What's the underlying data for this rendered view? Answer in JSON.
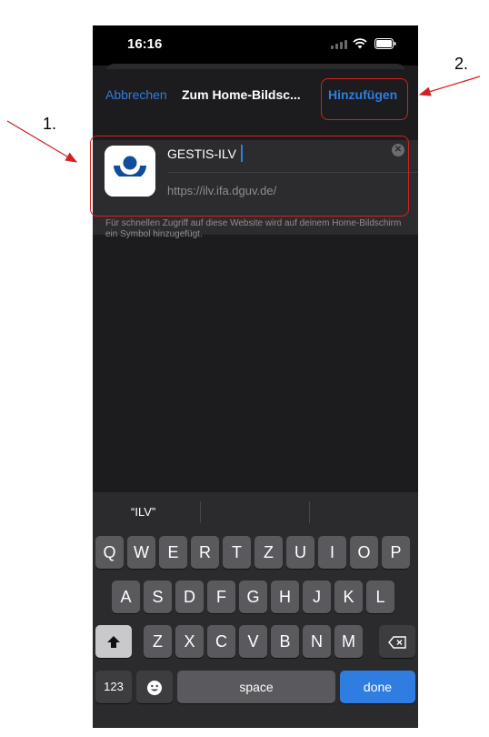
{
  "status_bar": {
    "time": "16:16"
  },
  "navbar": {
    "cancel_label": "Abbrechen",
    "title": "Zum Home-Bildsc...",
    "add_label": "Hinzufügen"
  },
  "shortcut": {
    "name": "GESTIS-ILV",
    "url": "https://ilv.ifa.dguv.de/",
    "hint": "Für schnellen Zugriff auf diese Website wird auf deinem Home-Bildschirm ein Symbol hinzugefügt."
  },
  "keyboard": {
    "suggestion": "“ILV”",
    "row1": [
      "Q",
      "W",
      "E",
      "R",
      "T",
      "Z",
      "U",
      "I",
      "O",
      "P"
    ],
    "row2": [
      "A",
      "S",
      "D",
      "F",
      "G",
      "H",
      "J",
      "K",
      "L"
    ],
    "row3": [
      "Z",
      "X",
      "C",
      "V",
      "B",
      "N",
      "M"
    ],
    "numbers_label": "123",
    "space_label": "space",
    "done_label": "done"
  },
  "annotations": {
    "label_1": "1.",
    "label_2": "2."
  },
  "colors": {
    "accent": "#2f7de1",
    "annotation": "#d42020",
    "icon_blue": "#0f4d9e"
  },
  "icons": [
    "signal-icon",
    "wifi-icon",
    "battery-icon",
    "clear-icon",
    "shift-icon",
    "delete-icon",
    "emoji-icon",
    "globe-icon",
    "mic-icon",
    "app-logo-icon"
  ]
}
